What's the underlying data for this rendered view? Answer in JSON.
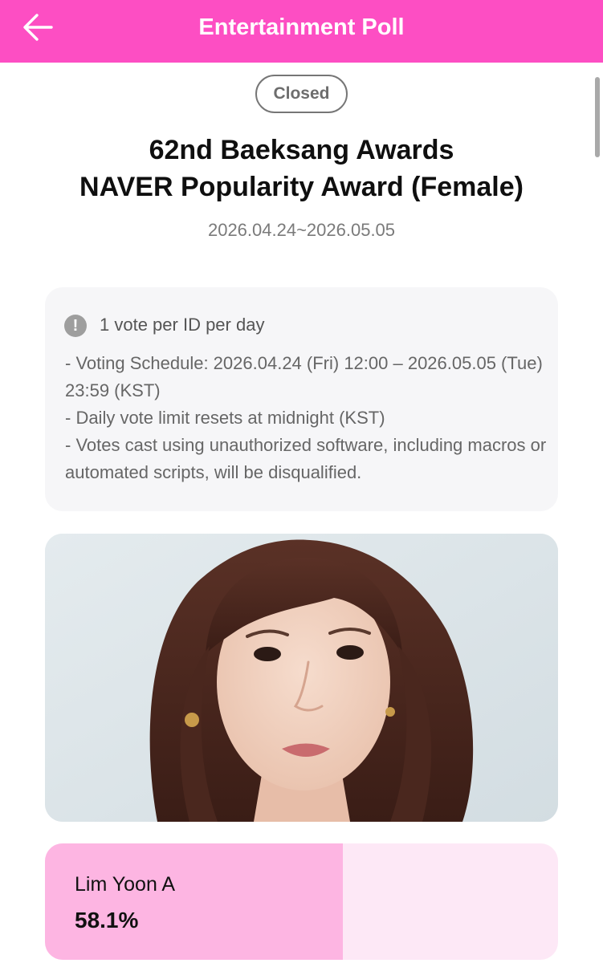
{
  "header": {
    "title": "Entertainment Poll",
    "back_icon": "arrow-left-icon",
    "background_color": "#fd4ec3"
  },
  "poll": {
    "status": "Closed",
    "title_lines": [
      "62nd Baeksang Awards",
      "NAVER Popularity Award (Female)"
    ],
    "date_range": "2026.04.24~2026.05.05"
  },
  "notice": {
    "icon": "exclamation-circle-icon",
    "heading": "1 vote per ID per day",
    "lines": [
      "- Voting Schedule: 2026.04.24 (Fri) 12:00 – 2026.05.05 (Tue) 23:59 (KST)",
      "- Daily vote limit resets at midnight (KST)",
      "- Votes cast using unauthorized software, including macros or automated scripts, will be disqualified."
    ]
  },
  "candidate": {
    "name": "Lim Yoon A",
    "percent_label": "58.1%",
    "percent_value": 58.1,
    "bar_color": "#fdb5e2",
    "track_color": "#fde8f6"
  }
}
